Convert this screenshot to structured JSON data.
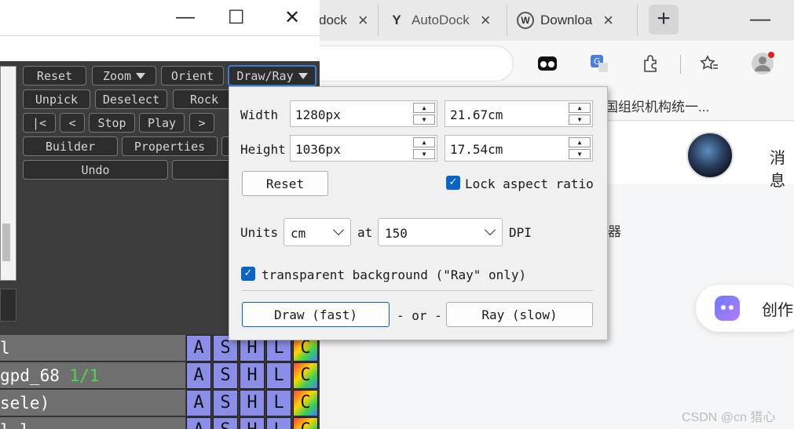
{
  "browser": {
    "tabs": [
      {
        "label": "dock",
        "icon": ""
      },
      {
        "label": "AutoDock",
        "icon": "Y"
      },
      {
        "label": "Downloa",
        "icon": "W"
      }
    ],
    "new_tab": "+",
    "minimize": "—",
    "bookmark_text": "国组织机构统一...",
    "header_msg": "消息",
    "page_sub": "器",
    "create_label": "创作",
    "watermark": "CSDN @cn 猎心"
  },
  "app": {
    "window": {
      "minimize": "—",
      "maximize": "☐",
      "close": "✕"
    },
    "buttons": {
      "row1": [
        "Reset",
        "Zoom",
        "Orient",
        "Draw/Ray"
      ],
      "row2": [
        "Unpick",
        "Deselect",
        "Rock"
      ],
      "row3": [
        "|<",
        "<",
        "Stop",
        "Play",
        ">"
      ],
      "row4": [
        "Builder",
        "Properties"
      ],
      "row5": [
        "Undo"
      ]
    },
    "objects": [
      {
        "name": "l",
        "frac": ""
      },
      {
        "name": "gpd_68",
        "frac": "1/1"
      },
      {
        "name": "sele)",
        "frac": ""
      },
      {
        "name": "l      l   ",
        "frac": ""
      }
    ],
    "cell_letters": [
      "A",
      "S",
      "H",
      "L",
      "C"
    ]
  },
  "dialog": {
    "width_label": "Width",
    "height_label": "Height",
    "width_px": "1280px",
    "width_cm": "21.67cm",
    "height_px": "1036px",
    "height_cm": "17.54cm",
    "reset_label": "Reset",
    "lock_aspect_label": "Lock aspect ratio",
    "lock_aspect_checked": true,
    "units_label": "Units",
    "units_value": "cm",
    "at_label": "at",
    "dpi_value": "150",
    "dpi_label": "DPI",
    "transparent_label": "transparent background (\"Ray\" only)",
    "transparent_checked": true,
    "draw_label": "Draw (fast)",
    "or_label": "- or -",
    "ray_label": "Ray (slow)"
  }
}
